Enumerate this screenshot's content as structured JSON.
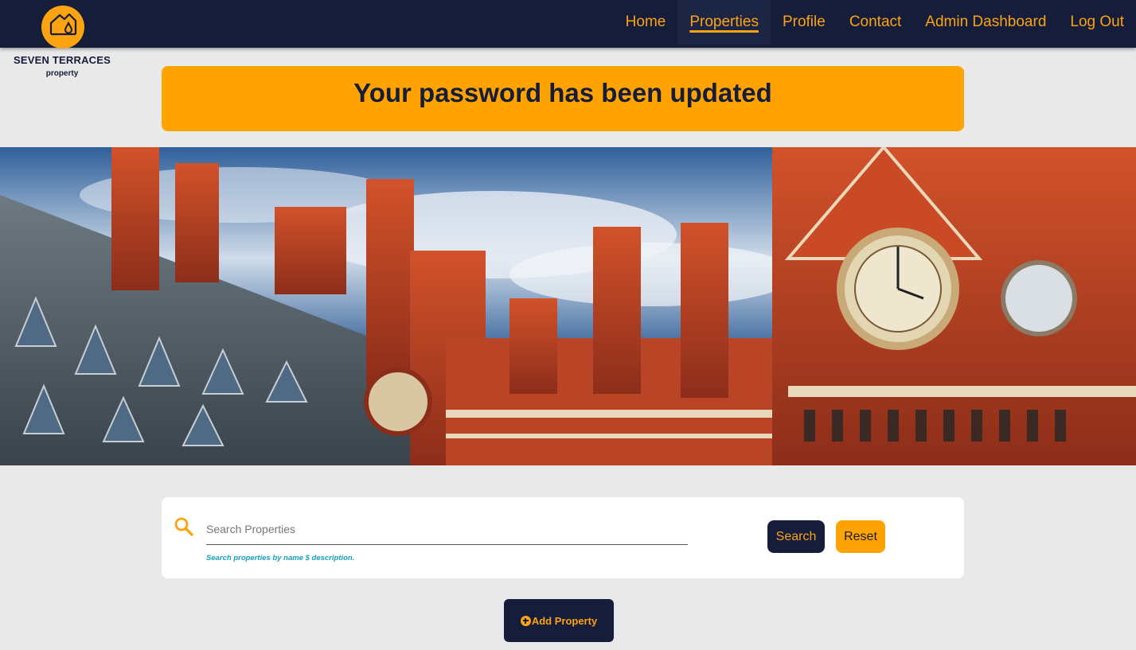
{
  "brand": {
    "name": "SEVEN TERRACES",
    "sub": "property",
    "logo_icon": "house-drop-icon",
    "accent_color": "#fca311",
    "dark_color": "#151d3b"
  },
  "nav": {
    "items": [
      {
        "label": "Home",
        "active": false
      },
      {
        "label": "Properties",
        "active": true
      },
      {
        "label": "Profile",
        "active": false
      },
      {
        "label": "Contact",
        "active": false
      },
      {
        "label": "Admin Dashboard",
        "active": false
      },
      {
        "label": "Log Out",
        "active": false
      }
    ]
  },
  "alert": {
    "message": "Your password has been updated"
  },
  "hero": {
    "image": "victorian-brick-building-clock-tower-photo"
  },
  "search": {
    "icon": "search-icon",
    "placeholder": "Search Properties",
    "value": "",
    "help_text": "Search properties by name $ description.",
    "search_label": "Search",
    "reset_label": "Reset"
  },
  "add_property": {
    "icon": "plus-circle-icon",
    "label": "Add Property"
  }
}
